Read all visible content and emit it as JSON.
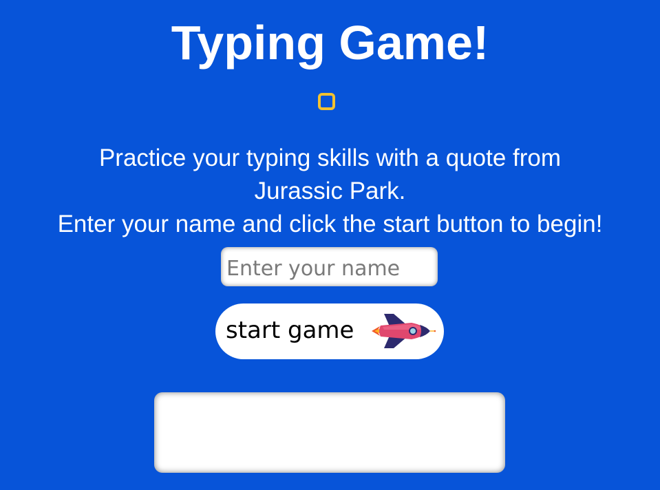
{
  "page": {
    "title": "Typing Game!"
  },
  "icons": {
    "status": "square-outline-icon",
    "rocket": "rocket-icon"
  },
  "description": {
    "line1": "Practice your typing skills with a quote from",
    "line2": "Jurassic Park.",
    "line3": "Enter your name and click the start button to begin!"
  },
  "form": {
    "name_placeholder": "Enter your name",
    "name_value": "",
    "start_label": "start game"
  },
  "output": {
    "text": ""
  },
  "colors": {
    "background": "#0754d9",
    "accent": "#f2c230",
    "text": "#ffffff",
    "rocket_body": "#e0476e",
    "rocket_fins": "#2d2a6e"
  }
}
